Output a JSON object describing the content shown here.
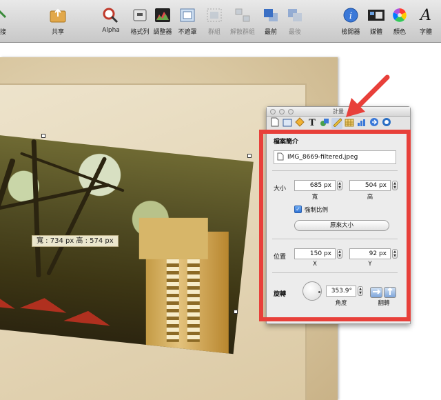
{
  "toolbar": {
    "items": [
      {
        "label": "連接",
        "icon": "link-icon",
        "disabled": false
      },
      {
        "label": "共享",
        "icon": "share-icon",
        "disabled": false
      },
      {
        "label": "Alpha",
        "icon": "alpha-wand-icon",
        "disabled": false
      },
      {
        "label": "格式列",
        "icon": "format-bar-icon",
        "disabled": false
      },
      {
        "label": "調整器",
        "icon": "adjust-histogram-icon",
        "disabled": false
      },
      {
        "label": "不遮罩",
        "icon": "unmask-icon",
        "disabled": false
      },
      {
        "label": "群組",
        "icon": "group-icon",
        "disabled": true
      },
      {
        "label": "解散群組",
        "icon": "ungroup-icon",
        "disabled": true
      },
      {
        "label": "最前",
        "icon": "bring-front-icon",
        "disabled": false
      },
      {
        "label": "最後",
        "icon": "send-back-icon",
        "disabled": true
      },
      {
        "label": "檢閱器",
        "icon": "inspector-icon",
        "disabled": false
      },
      {
        "label": "媒體",
        "icon": "media-icon",
        "disabled": false
      },
      {
        "label": "顏色",
        "icon": "color-wheel-icon",
        "disabled": false
      },
      {
        "label": "字體",
        "icon": "font-icon",
        "disabled": false
      }
    ]
  },
  "canvas": {
    "size_tooltip": "寬 : 734 px   高 : 574 px"
  },
  "inspector": {
    "title": "計量",
    "file_section_title": "檔案簡介",
    "file_name": "IMG_8669-filtered.jpeg",
    "size_label": "大小",
    "width_value": "685 px",
    "width_caption": "寬",
    "height_value": "504 px",
    "height_caption": "高",
    "constrain_label": "強制比例",
    "constrain_checked": true,
    "original_size_button": "原來大小",
    "position_label": "位置",
    "x_value": "150 px",
    "x_caption": "X",
    "y_value": "92 px",
    "y_caption": "Y",
    "rotate_label": "旋轉",
    "angle_value": "353.9°",
    "angle_caption": "角度",
    "flip_caption": "翻轉"
  },
  "colors": {
    "highlight_red": "#e8403a",
    "selected_tab": "#c8d4e8"
  }
}
